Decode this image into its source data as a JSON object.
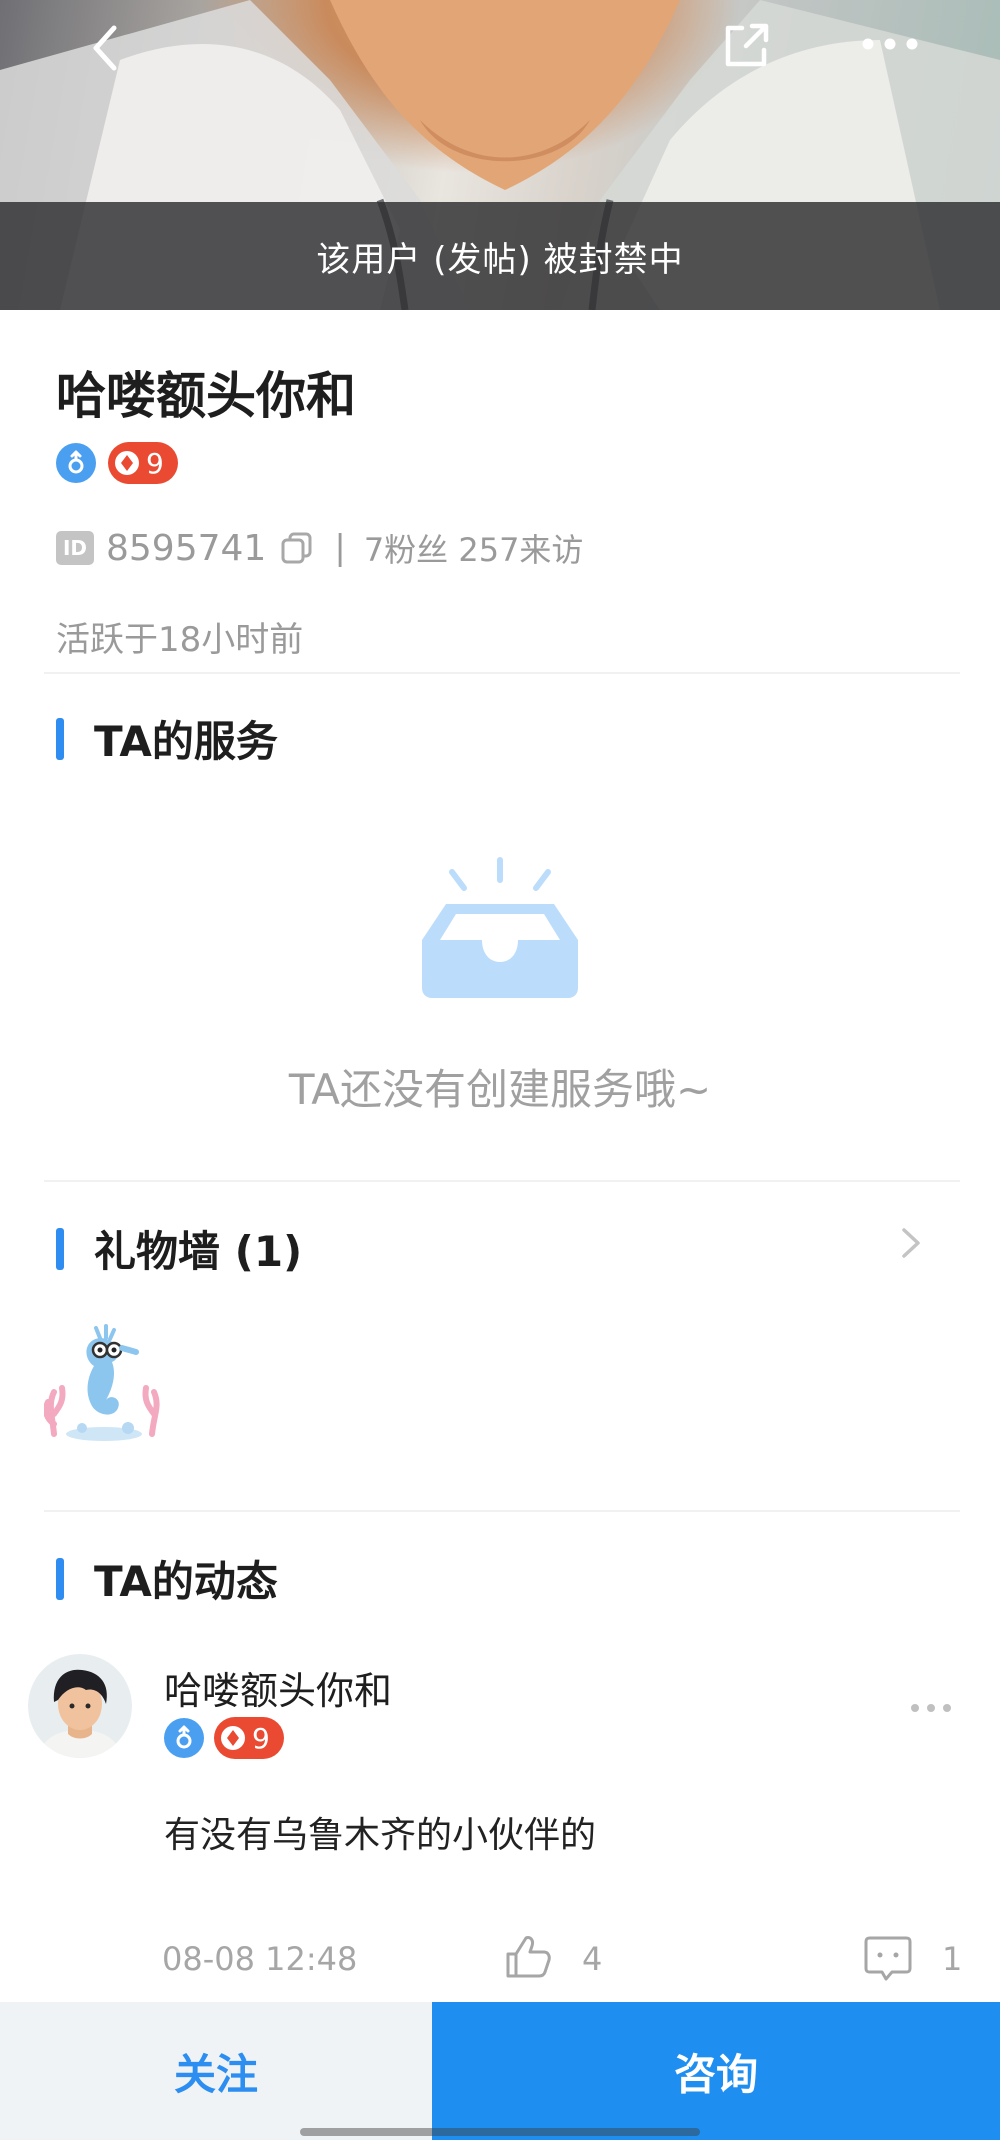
{
  "header": {
    "ban_notice": "该用户 (发帖) 被封禁中"
  },
  "profile": {
    "name": "哈喽额头你和",
    "gender": "male",
    "level": "9",
    "id_label": "ID",
    "id_number": "8595741",
    "separator": "|",
    "stats": "7粉丝 257来访",
    "active": "活跃于18小时前"
  },
  "services": {
    "title": "TA的服务",
    "empty_text": "TA还没有创建服务哦~"
  },
  "gifts": {
    "title": "礼物墙 (1)"
  },
  "feed": {
    "title": "TA的动态",
    "post": {
      "author": "哈喽额头你和",
      "level": "9",
      "text": "有没有乌鲁木齐的小伙伴的",
      "time": "08-08 12:48",
      "likes": "4",
      "comments": "1"
    }
  },
  "bottom_bar": {
    "follow_label": "关注",
    "consult_label": "咨询"
  },
  "colors": {
    "accent": "#2f8cf0",
    "level_badge": "#ea4a32",
    "gender_badge": "#4a9ff0"
  }
}
